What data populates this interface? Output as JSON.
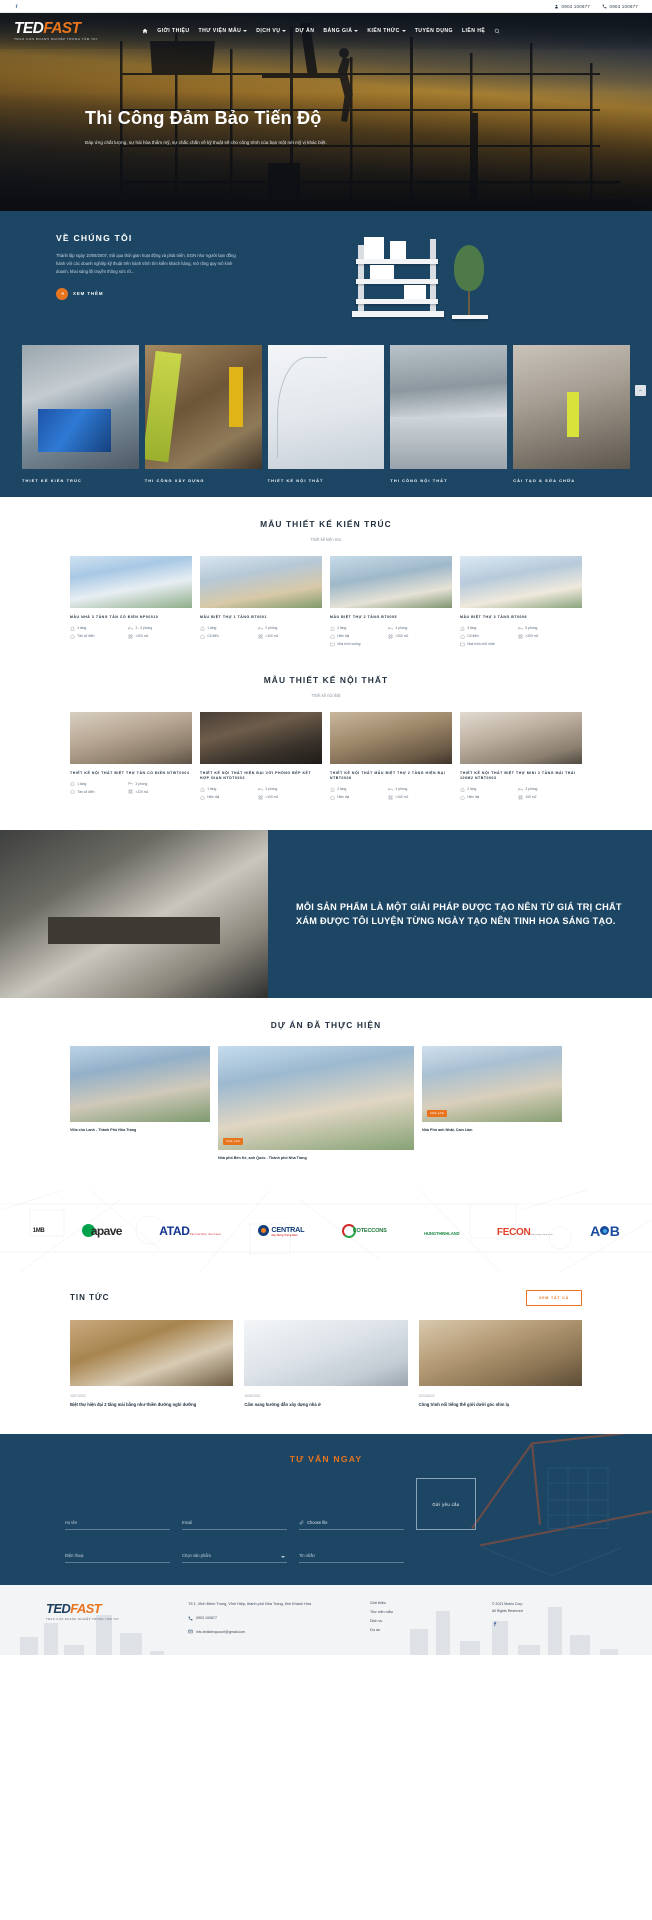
{
  "topbar": {
    "facebook_icon": "facebook-icon",
    "contacts": [
      {
        "icon": "user-phone-icon",
        "text": "0903 100877"
      },
      {
        "icon": "phone-icon",
        "text": "0903 100877"
      }
    ]
  },
  "brand": {
    "name_first": "TED",
    "name_second": "FAST",
    "tagline": "TRAO CON DOANH NGHIỆP TRONG TẦM TAY"
  },
  "nav": {
    "home_icon": "home-icon",
    "search_icon": "search-icon",
    "items": [
      {
        "label": "GIỚI THIỆU",
        "has_caret": false
      },
      {
        "label": "THƯ VIỆN MẪU",
        "has_caret": true
      },
      {
        "label": "DỊCH VỤ",
        "has_caret": true
      },
      {
        "label": "DỰ ÁN",
        "has_caret": false
      },
      {
        "label": "BẢNG GIÁ",
        "has_caret": true
      },
      {
        "label": "KIẾN THỨC",
        "has_caret": true
      },
      {
        "label": "TUYỂN DỤNG",
        "has_caret": false
      },
      {
        "label": "LIÊN HỆ",
        "has_caret": false
      }
    ]
  },
  "hero": {
    "title": "Thi Công Đảm Bảo Tiến Độ",
    "subtitle": "Đáp ứng chất lượng, sự hài hòa thẩm mỹ, sự chắc chắn về kỹ thuật sẽ cho công trình của bạn một nét mỹ vị khác biệt."
  },
  "about": {
    "title": "VỀ CHÚNG TÔI",
    "text": "Thành lập ngày 10/06/2007, trải qua thời gian hoạt động và phát triển, EGN như người bạn đồng hành với các doanh nghiệp kỹ thuật trên hành trình tìm kiếm khách hàng, mở rộng quy mô kinh doanh, khai sáng lối truyền thông sức rõ...",
    "button": "XEM THÊM",
    "button_icon": "arrow-right-icon"
  },
  "categories": [
    {
      "label": "THIẾT KẾ KIẾN TRÚC",
      "image": "solar-panel-technician"
    },
    {
      "label": "THI CÔNG XÂY DỰNG",
      "image": "construction-worker"
    },
    {
      "label": "THIẾT KẾ NỘI THẤT",
      "image": "interior-staircase"
    },
    {
      "label": "THI CÔNG NỘI THẤT",
      "image": "warehouse-interior"
    },
    {
      "label": "CẢI TẠO & SỬA CHỮA",
      "image": "renovation-worker"
    }
  ],
  "architecture": {
    "title": "MẪU THIẾT KẾ KIẾN TRÚC",
    "subtitle": "Thiết kế kiến trúc",
    "items": [
      {
        "name": "MẪU NHÀ 3 TẦNG TÂN CỔ ĐIỂN NP00010",
        "image": "classic-3story-house",
        "specs": [
          {
            "icon": "floors-icon",
            "text": "4 tầng"
          },
          {
            "icon": "bed-icon",
            "text": "3 - 4 phòng"
          },
          {
            "icon": "house-icon",
            "text": "Tân cổ điển"
          },
          {
            "icon": "area-icon",
            "text": ">200 m2"
          }
        ]
      },
      {
        "name": "MẪU BIỆT THỰ 1 TẦNG BT0001",
        "image": "single-story-villa",
        "specs": [
          {
            "icon": "floors-icon",
            "text": "1 tầng"
          },
          {
            "icon": "bed-icon",
            "text": "2 phòng"
          },
          {
            "icon": "house-icon",
            "text": "Cổ điển"
          },
          {
            "icon": "area-icon",
            "text": ">100 m2"
          }
        ]
      },
      {
        "name": "MẪU BIỆT THỰ 2 TẦNG BT0005",
        "image": "modern-2story-villa",
        "specs": [
          {
            "icon": "floors-icon",
            "text": "2 tầng"
          },
          {
            "icon": "bed-icon",
            "text": "4 phòng"
          },
          {
            "icon": "house-icon",
            "text": "Hiện đại"
          },
          {
            "icon": "area-icon",
            "text": ">200 m2"
          },
          {
            "icon": "style-icon",
            "text": "Nhà hình vuông"
          }
        ]
      },
      {
        "name": "MẪU BIỆT THỰ 3 TẦNG BT0006",
        "image": "three-story-villa",
        "specs": [
          {
            "icon": "floors-icon",
            "text": "3 tầng"
          },
          {
            "icon": "bed-icon",
            "text": "5 phòng"
          },
          {
            "icon": "house-icon",
            "text": "Cổ điển"
          },
          {
            "icon": "area-icon",
            "text": ">200 m2"
          },
          {
            "icon": "style-icon",
            "text": "Nhà hình chữ nhật"
          }
        ]
      }
    ]
  },
  "interior": {
    "title": "MẪU THIẾT KẾ NỘI THẤT",
    "subtitle": "Thiết kế nội thất",
    "items": [
      {
        "name": "THIẾT KẾ NỘI THẤT BIỆT THỰ TÂN CỔ ĐIỂN NTWT0004",
        "image": "classic-villa-interior",
        "specs": [
          {
            "icon": "floors-icon",
            "text": "1 tầng"
          },
          {
            "icon": "bed-icon",
            "text": "3 phòng"
          },
          {
            "icon": "area-icon",
            "text": "Tân cổ điển"
          },
          {
            "icon": "size-icon",
            "text": ">220 m2"
          }
        ]
      },
      {
        "name": "THIẾT KẾ NỘI THẤT HIỆN ĐẠI VỚI PHÒNG BẾP KẾT HỢP GIAN NTDT0002",
        "image": "modern-kitchen-interior",
        "specs": [
          {
            "icon": "floors-icon",
            "text": "1 tầng"
          },
          {
            "icon": "bed-icon",
            "text": "3 phòng"
          },
          {
            "icon": "area-icon",
            "text": "Hiện đại"
          },
          {
            "icon": "size-icon",
            "text": ">100 m2"
          }
        ]
      },
      {
        "name": "THIẾT KẾ NỘI THẤT MẪU BIỆT THỰ 2 TẦNG HIỆN ĐẠI NTBT0006",
        "image": "living-room-interior",
        "specs": [
          {
            "icon": "floors-icon",
            "text": "2 tầng"
          },
          {
            "icon": "bed-icon",
            "text": "4 phòng"
          },
          {
            "icon": "area-icon",
            "text": "Hiện đại"
          },
          {
            "icon": "size-icon",
            "text": ">100 m2"
          }
        ]
      },
      {
        "name": "THIẾT KẾ NỘI THẤT BIỆT THỰ MINI 2 TẦNG MÁI THÁI 100M2 NTBT0003",
        "image": "mini-villa-interior",
        "specs": [
          {
            "icon": "floors-icon",
            "text": "2 tầng"
          },
          {
            "icon": "bed-icon",
            "text": "3 phòng"
          },
          {
            "icon": "area-icon",
            "text": "Hiện đại"
          },
          {
            "icon": "size-icon",
            "text": "100 m2"
          }
        ]
      }
    ]
  },
  "quote": {
    "text": "MỖI SẢN PHẨM LÀ MỘT GIẢI PHÁP ĐƯỢC TẠO NÊN TỪ GIÁ TRỊ CHẤT XÁM ĐƯỢC TÔI LUYỆN TỪNG NGÀY TẠO NÊN TINH HOA SÁNG TẠO.",
    "image": "architect-model-workspace"
  },
  "projects": {
    "title": "DỰ ÁN ĐÃ THỰC HIỆN",
    "items": [
      {
        "badge": "",
        "caption": "Villa chú Lanh - Thành Phố Nha Trang",
        "image": "villa-nha-trang"
      },
      {
        "badge": "Nhà phố",
        "caption": "Nhà phố Bến Ké, anh Quốc - Thành phố Nha Trang",
        "image": "townhouse-nha-trang"
      },
      {
        "badge": "Nhà phố",
        "caption": "Nhà Phố anh Nhật, Cam Lâm",
        "image": "house-cam-lam"
      }
    ]
  },
  "partners": [
    {
      "name": "1MB"
    },
    {
      "name": "apave"
    },
    {
      "name": "ATAD",
      "sub": "Partnership Success"
    },
    {
      "name": "CENTRAL",
      "sub": "Xây Dựng Trung Nam"
    },
    {
      "name": "COTECCONS"
    },
    {
      "name": "HUNGTHINHLAND"
    },
    {
      "name": "FECON",
      "sub": "Nền móng công trình"
    },
    {
      "name": "ACB"
    }
  ],
  "news": {
    "title": "TIN TỨC",
    "view_all": "XEM TẤT CẢ",
    "items": [
      {
        "date": "22/07/2022",
        "title": "Biệt thự hiện đại 2 tầng mái bằng như thiên đường nghỉ dưỡng",
        "image": "modern-villa-news"
      },
      {
        "date": "19/04/2022",
        "title": "Cẩm nang hướng dẫn xây dựng nhà ở",
        "image": "blueprint-news"
      },
      {
        "date": "22/03/2022",
        "title": "Công trình nổi tiếng thế giới dưới góc nhìn lạ",
        "image": "famous-buildings-news"
      }
    ]
  },
  "contact": {
    "title": "TƯ VẤN NGAY",
    "fields": {
      "name_placeholder": "Họ tên",
      "email_placeholder": "Email",
      "file_label": "Choose file",
      "file_icon": "paperclip-icon",
      "phone_placeholder": "Điện thoại",
      "product_placeholder": "Chọn sản phẩm",
      "message_placeholder": "Tin nhắn"
    },
    "submit": "Gửi yêu cầu"
  },
  "footer": {
    "address": "Tổ 1, Vĩnh Điềm Trung, Vĩnh Hiệp, thành phố Nha Trang, tỉnh Khánh Hòa",
    "phone": "0903 100877",
    "phone_icon": "phone-icon",
    "email": "info.tedkienquocnt@gmail.com",
    "email_icon": "mail-icon",
    "links": [
      "Giới thiệu",
      "Thư viện mẫu",
      "Dịch vụ",
      "Dự án"
    ],
    "copyright_line1": "© 2021 Mobio Corp",
    "copyright_line2": "All Rights Reserved",
    "facebook_icon": "facebook-icon"
  },
  "scroll_top_icon": "chevron-up-icon",
  "colors": {
    "navy": "#1d4665",
    "orange": "#e8741e",
    "text": "#22303f"
  }
}
